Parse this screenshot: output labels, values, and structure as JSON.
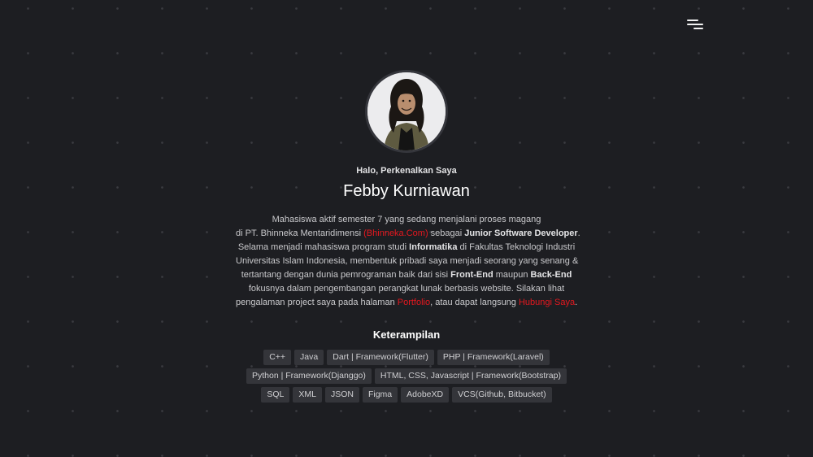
{
  "menu": {
    "icon": "hamburger-menu-icon"
  },
  "profile": {
    "avatar_icon": "profile-photo",
    "greeting": "Halo, Perkenalkan Saya",
    "name": "Febby Kurniawan"
  },
  "bio": {
    "line1": "Mahasiswa aktif semester 7 yang sedang menjalani proses magang",
    "line2_before": "di PT. Bhinneka Mentaridimensi ",
    "line2_link": "(Bhinneka.Com)",
    "line2_mid": " sebagai ",
    "line2_strong": "Junior Software Developer",
    "line2_after": ".",
    "line3_before": "Selama menjadi mahasiswa program studi ",
    "line3_strong": "Informatika",
    "line3_after": " di Fakultas Teknologi Industri",
    "line4": "Universitas Islam Indonesia, membentuk pribadi saya menjadi seorang yang senang &",
    "line5_before": "tertantang dengan dunia pemrograman baik dari sisi ",
    "line5_strong1": "Front-End",
    "line5_mid": " maupun ",
    "line5_strong2": "Back-End",
    "line6": "fokusnya dalam pengembangan perangkat lunak berbasis website. Silakan lihat",
    "line7_before": "pengalaman project saya pada halaman ",
    "line7_link1": "Portfolio",
    "line7_mid": ", atau dapat langsung ",
    "line7_link2": "Hubungi Saya",
    "line7_after": "."
  },
  "skills": {
    "title": "Keterampilan",
    "rows": [
      [
        "C++",
        "Java",
        "Dart | Framework(Flutter)",
        "PHP | Framework(Laravel)"
      ],
      [
        "Python | Framework(Djanggo)",
        "HTML, CSS, Javascript | Framework(Bootstrap)"
      ],
      [
        "SQL",
        "XML",
        "JSON",
        "Figma",
        "AdobeXD",
        "VCS(Github, Bitbucket)"
      ]
    ]
  },
  "colors": {
    "background": "#1d1e22",
    "accent": "#e5181f",
    "chip": "#34353a",
    "text": "#c9c9cc"
  }
}
